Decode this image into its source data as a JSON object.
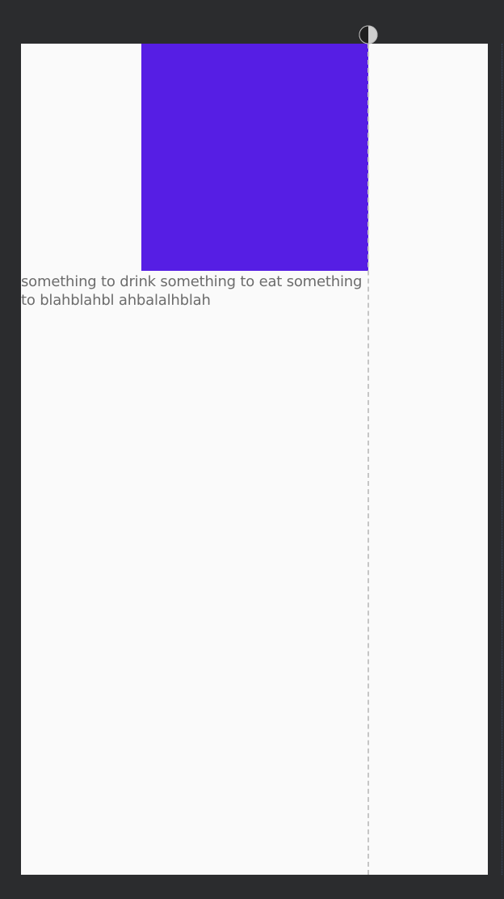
{
  "layout_preview": {
    "text": "something to drink something to eat something to blahblahbl ahbalalhblah",
    "box_color": "#561ee4",
    "screen_background": "#fafafa",
    "canvas_background": "#2b2c2e",
    "guideline_handle_icon": "half-circle-icon"
  }
}
